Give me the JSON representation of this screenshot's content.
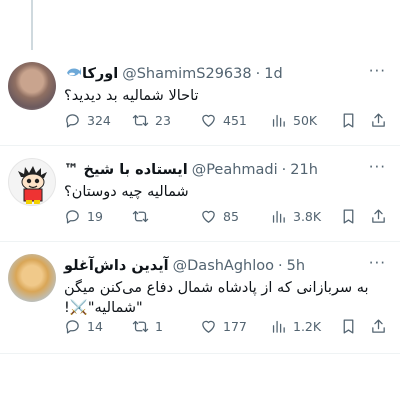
{
  "tweets": [
    {
      "display_name": "اورکا",
      "badge_icon": "orca-whale-icon",
      "handle": "@ShamimS29638",
      "time": "1d",
      "separator": "·",
      "text": "تاحالا شمالیه بد دیدید؟",
      "replies": "324",
      "reposts": "23",
      "likes": "451",
      "views": "50K"
    },
    {
      "display_name": "ایستاده با شیخ ™",
      "handle": "@Peahmadi",
      "time": "21h",
      "separator": "·",
      "text": "شمالیه چیه دوستان؟",
      "replies": "19",
      "reposts": "",
      "likes": "85",
      "views": "3.8K"
    },
    {
      "display_name": "آیدین داش‌آغلو",
      "handle": "@DashAghloo",
      "time": "5h",
      "separator": "·",
      "text_line1": "به سربازانی که از پادشاه شمال دفاع می‌کنن میگن",
      "text_line2": "\"شمالیه\"⚔️!",
      "replies": "14",
      "reposts": "1",
      "likes": "177",
      "views": "1.2K"
    }
  ],
  "more_label": "···"
}
